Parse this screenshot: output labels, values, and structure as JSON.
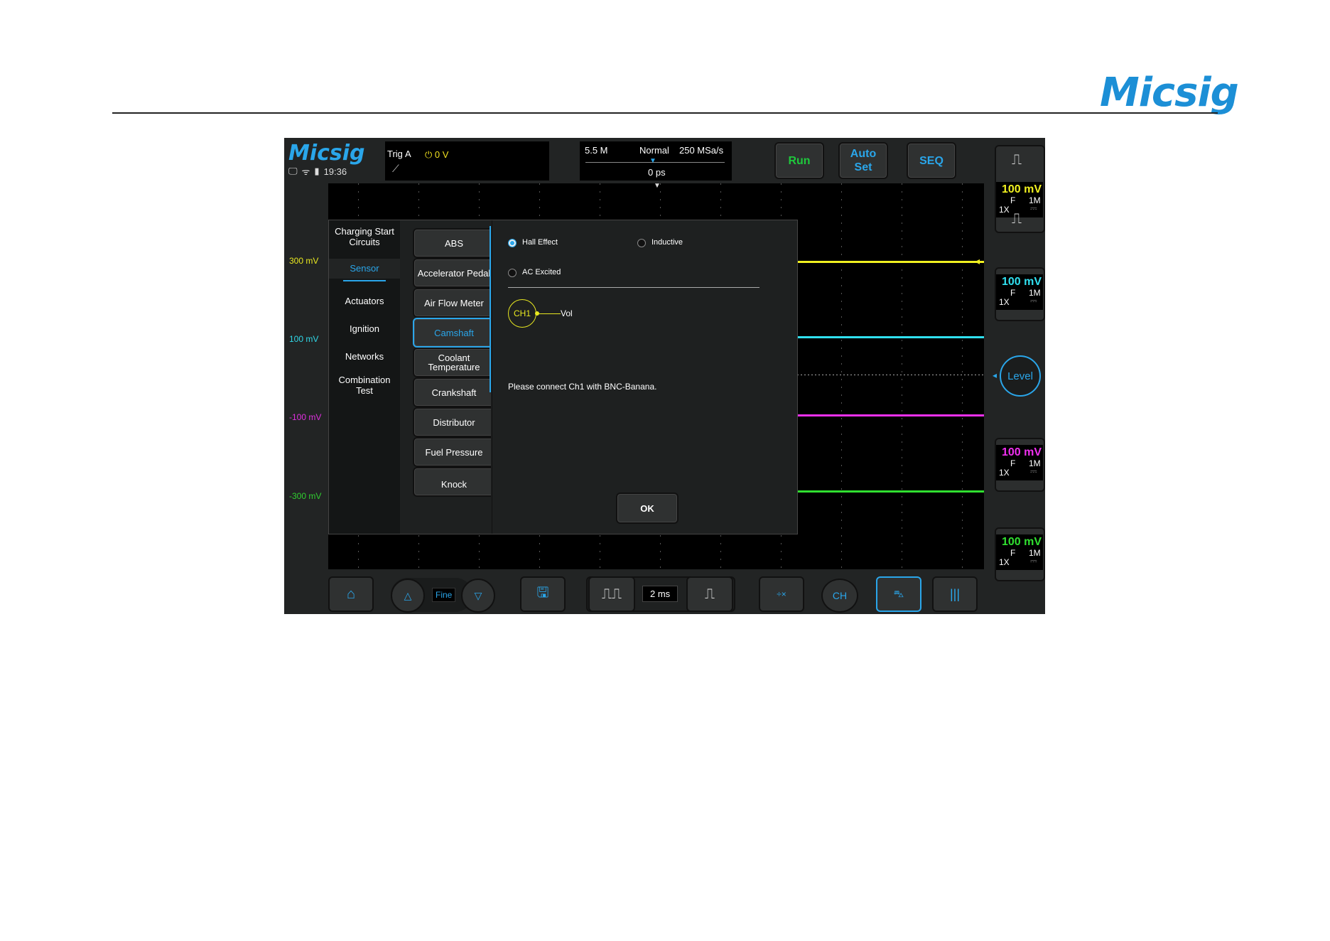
{
  "page": {
    "brand": "Micsig"
  },
  "scope": {
    "logo": "Micsig",
    "time": "19:36",
    "trigger": {
      "label": "Trig",
      "source": "A",
      "level": "0 V"
    },
    "timebase": {
      "memory": "5.5 M",
      "mode": "Normal",
      "rate": "250 MSa/s",
      "offset": "0 ps"
    },
    "buttons": {
      "run": "Run",
      "auto_set_1": "Auto",
      "auto_set_2": "Set",
      "seq": "SEQ"
    },
    "volt_labels": [
      {
        "text": "300 mV",
        "color": "#e8e820"
      },
      {
        "text": "100 mV",
        "color": "#30d8e8"
      },
      {
        "text": "-100 mV",
        "color": "#e030e0"
      },
      {
        "text": "-300 mV",
        "color": "#30d030"
      }
    ],
    "channels": [
      {
        "scale": "100 mV",
        "coupling": "F",
        "impedance": "1M",
        "probe": "1X",
        "dc": "⎓",
        "color": "#f0f020"
      },
      {
        "scale": "100 mV",
        "coupling": "F",
        "impedance": "1M",
        "probe": "1X",
        "dc": "⎓",
        "color": "#30e0f0"
      },
      {
        "scale": "100 mV",
        "coupling": "F",
        "impedance": "1M",
        "probe": "1X",
        "dc": "⎓",
        "color": "#f030f0"
      },
      {
        "scale": "100 mV",
        "coupling": "F",
        "impedance": "1M",
        "probe": "1X",
        "dc": "⎓",
        "color": "#30e030"
      }
    ],
    "level_button": "Level",
    "bottom": {
      "fine": "Fine",
      "timebase": "2 ms",
      "ch_label": "CH"
    }
  },
  "dialog": {
    "categories": [
      {
        "label": "Charging Start Circuits",
        "active": false
      },
      {
        "label": "Sensor",
        "active": true
      },
      {
        "label": "Actuators",
        "active": false
      },
      {
        "label": "Ignition",
        "active": false
      },
      {
        "label": "Networks",
        "active": false
      },
      {
        "label": "Combination Test",
        "active": false
      }
    ],
    "sensors": [
      {
        "label": "ABS",
        "active": false
      },
      {
        "label": "Accelerator Pedal",
        "active": false
      },
      {
        "label": "Air Flow Meter",
        "active": false
      },
      {
        "label": "Camshaft",
        "active": true
      },
      {
        "label": "Coolant Temperature",
        "active": false
      },
      {
        "label": "Crankshaft",
        "active": false
      },
      {
        "label": "Distributor",
        "active": false
      },
      {
        "label": "Fuel Pressure",
        "active": false
      },
      {
        "label": "Knock",
        "active": false
      }
    ],
    "options": {
      "hall": "Hall Effect",
      "inductive": "Inductive",
      "ac": "AC Excited"
    },
    "ch_badge": "CH1",
    "connector": "Vol",
    "message": "Please connect Ch1 with BNC-Banana.",
    "ok": "OK"
  }
}
